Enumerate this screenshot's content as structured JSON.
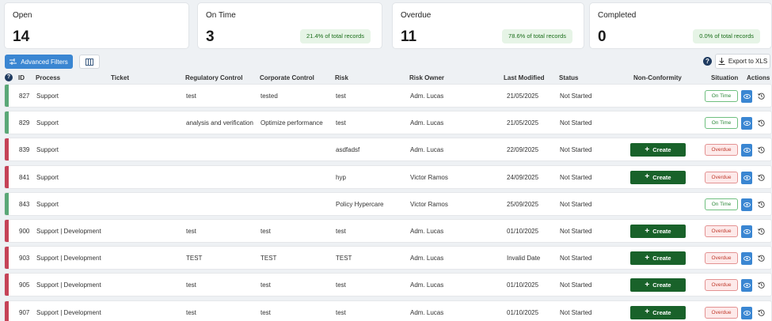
{
  "cards": [
    {
      "title": "Open",
      "value": "14",
      "pill": ""
    },
    {
      "title": "On Time",
      "value": "3",
      "pill": "21.4% of total records"
    },
    {
      "title": "Overdue",
      "value": "11",
      "pill": "78.6% of total records"
    },
    {
      "title": "Completed",
      "value": "0",
      "pill": "0.0% of total records"
    }
  ],
  "toolbar": {
    "filter_label": "Advanced Filters",
    "export_label": "Export to XLS",
    "help": "?"
  },
  "columns": {
    "help": "?",
    "id": "ID",
    "process": "Process",
    "ticket": "Ticket",
    "regulatory": "Regulatory Control",
    "corporate": "Corporate Control",
    "risk": "Risk",
    "owner": "Risk Owner",
    "modified": "Last Modified",
    "status": "Status",
    "nonconformity": "Non-Conformity",
    "situation": "Situation",
    "actions": "Actions"
  },
  "create_label": "Create",
  "icons": {
    "filter": "sliders-icon",
    "columns": "columns-icon",
    "export": "download-icon",
    "view": "eye-icon",
    "history": "history-icon",
    "create": "plus-icon"
  },
  "colors": {
    "accent": "#3a86d2",
    "create": "#19622a",
    "ontime": "#5aa877",
    "overdue": "#c54257"
  },
  "rows": [
    {
      "id": "827",
      "process": "Support",
      "ticket": "",
      "regulatory": "test",
      "corporate": "tested",
      "risk": "test",
      "owner": "Adm. Lucas",
      "modified": "21/05/2025",
      "status": "Not Started",
      "create": false,
      "situation": "On Time"
    },
    {
      "id": "829",
      "process": "Support",
      "ticket": "",
      "regulatory": "analysis and verification",
      "corporate": "Optimize performance",
      "risk": "test",
      "owner": "Adm. Lucas",
      "modified": "21/05/2025",
      "status": "Not Started",
      "create": false,
      "situation": "On Time"
    },
    {
      "id": "839",
      "process": "Support",
      "ticket": "",
      "regulatory": "",
      "corporate": "",
      "risk": "asdfadsf",
      "owner": "Adm. Lucas",
      "modified": "22/09/2025",
      "status": "Not Started",
      "create": true,
      "situation": "Overdue"
    },
    {
      "id": "841",
      "process": "Support",
      "ticket": "",
      "regulatory": "",
      "corporate": "",
      "risk": "hyp",
      "owner": "Victor Ramos",
      "modified": "24/09/2025",
      "status": "Not Started",
      "create": true,
      "situation": "Overdue"
    },
    {
      "id": "843",
      "process": "Support",
      "ticket": "",
      "regulatory": "",
      "corporate": "",
      "risk": "Policy Hypercare",
      "owner": "Victor Ramos",
      "modified": "25/09/2025",
      "status": "Not Started",
      "create": false,
      "situation": "On Time"
    },
    {
      "id": "900",
      "process": "Support | Development",
      "ticket": "",
      "regulatory": "test",
      "corporate": "test",
      "risk": "test",
      "owner": "Adm. Lucas",
      "modified": "01/10/2025",
      "status": "Not Started",
      "create": true,
      "situation": "Overdue"
    },
    {
      "id": "903",
      "process": "Support | Development",
      "ticket": "",
      "regulatory": "TEST",
      "corporate": "TEST",
      "risk": "TEST",
      "owner": "Adm. Lucas",
      "modified": "Invalid Date",
      "status": "Not Started",
      "create": true,
      "situation": "Overdue"
    },
    {
      "id": "905",
      "process": "Support | Development",
      "ticket": "",
      "regulatory": "test",
      "corporate": "test",
      "risk": "test",
      "owner": "Adm. Lucas",
      "modified": "01/10/2025",
      "status": "Not Started",
      "create": true,
      "situation": "Overdue"
    },
    {
      "id": "907",
      "process": "Support | Development",
      "ticket": "",
      "regulatory": "test",
      "corporate": "test",
      "risk": "test",
      "owner": "Adm. Lucas",
      "modified": "01/10/2025",
      "status": "Not Started",
      "create": true,
      "situation": "Overdue"
    }
  ]
}
